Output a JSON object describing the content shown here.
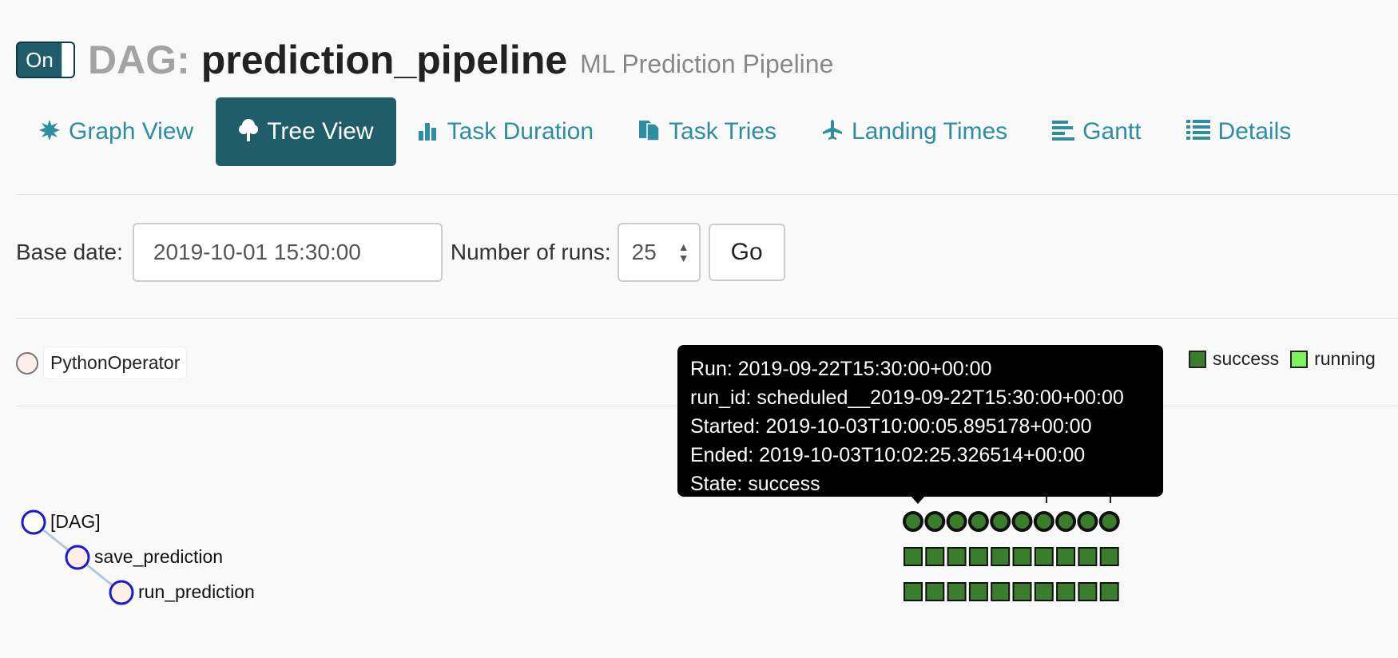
{
  "header": {
    "toggle_label": "On",
    "dag_prefix": "DAG:",
    "dag_name": "prediction_pipeline",
    "description": "ML Prediction Pipeline"
  },
  "tabs": [
    {
      "label": "Graph View",
      "icon": "graph-icon"
    },
    {
      "label": "Tree View",
      "icon": "tree-icon",
      "active": true
    },
    {
      "label": "Task Duration",
      "icon": "bar-chart-icon"
    },
    {
      "label": "Task Tries",
      "icon": "duplicate-icon"
    },
    {
      "label": "Landing Times",
      "icon": "plane-icon"
    },
    {
      "label": "Gantt",
      "icon": "gantt-icon"
    },
    {
      "label": "Details",
      "icon": "list-icon"
    }
  ],
  "form": {
    "base_date_label": "Base date:",
    "base_date_value": "2019-10-01 15:30:00",
    "runs_label": "Number of runs:",
    "runs_value": "25",
    "go_label": "Go"
  },
  "operator_legend": {
    "label": "PythonOperator",
    "color": "#fdeee8"
  },
  "state_legend": [
    {
      "label": "success",
      "color": "#3a7d2a"
    },
    {
      "label": "running",
      "color": "#7cf55a"
    }
  ],
  "tree": {
    "nodes": [
      {
        "label": "[DAG]"
      },
      {
        "label": "save_prediction"
      },
      {
        "label": "run_prediction"
      }
    ]
  },
  "grid": {
    "runs_count": 10,
    "rows": [
      "[DAG]",
      "save_prediction",
      "run_prediction"
    ],
    "state": "success",
    "color": "#3a7d2a"
  },
  "tooltip": {
    "run": "Run: 2019-09-22T15:30:00+00:00",
    "run_id": "run_id: scheduled__2019-09-22T15:30:00+00:00",
    "started": "Started: 2019-10-03T10:00:05.895178+00:00",
    "ended": "Ended: 2019-10-03T10:02:25.326514+00:00",
    "state": "State: success"
  }
}
